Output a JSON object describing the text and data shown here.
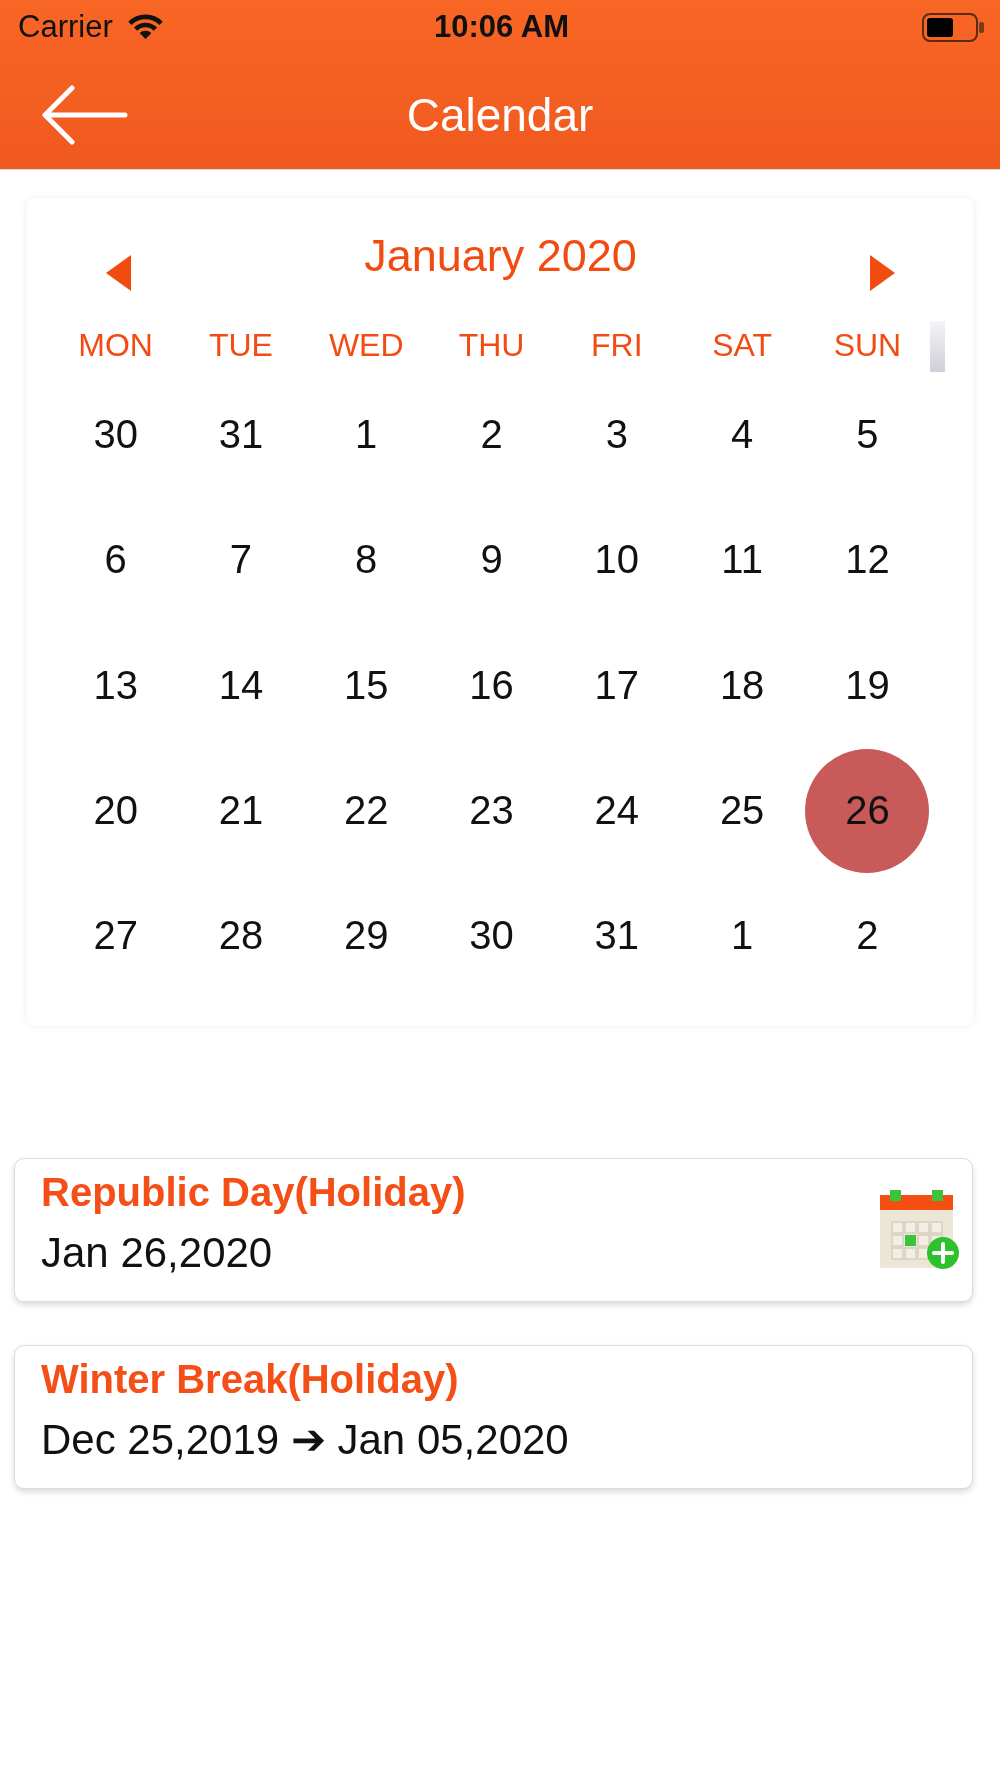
{
  "status_bar": {
    "carrier": "Carrier",
    "time": "10:06 AM"
  },
  "header": {
    "title": "Calendar"
  },
  "calendar": {
    "month": "January 2020",
    "weekdays": [
      "MON",
      "TUE",
      "WED",
      "THU",
      "FRI",
      "SAT",
      "SUN"
    ],
    "weeks": [
      [
        {
          "day": "30",
          "selected": false
        },
        {
          "day": "31",
          "selected": false
        },
        {
          "day": "1",
          "selected": false
        },
        {
          "day": "2",
          "selected": false
        },
        {
          "day": "3",
          "selected": false
        },
        {
          "day": "4",
          "selected": false
        },
        {
          "day": "5",
          "selected": false
        }
      ],
      [
        {
          "day": "6",
          "selected": false
        },
        {
          "day": "7",
          "selected": false
        },
        {
          "day": "8",
          "selected": false
        },
        {
          "day": "9",
          "selected": false
        },
        {
          "day": "10",
          "selected": false
        },
        {
          "day": "11",
          "selected": false
        },
        {
          "day": "12",
          "selected": false
        }
      ],
      [
        {
          "day": "13",
          "selected": false
        },
        {
          "day": "14",
          "selected": false
        },
        {
          "day": "15",
          "selected": false
        },
        {
          "day": "16",
          "selected": false
        },
        {
          "day": "17",
          "selected": false
        },
        {
          "day": "18",
          "selected": false
        },
        {
          "day": "19",
          "selected": false
        }
      ],
      [
        {
          "day": "20",
          "selected": false
        },
        {
          "day": "21",
          "selected": false
        },
        {
          "day": "22",
          "selected": false
        },
        {
          "day": "23",
          "selected": false
        },
        {
          "day": "24",
          "selected": false
        },
        {
          "day": "25",
          "selected": false
        },
        {
          "day": "26",
          "selected": true
        }
      ],
      [
        {
          "day": "27",
          "selected": false
        },
        {
          "day": "28",
          "selected": false
        },
        {
          "day": "29",
          "selected": false
        },
        {
          "day": "30",
          "selected": false
        },
        {
          "day": "31",
          "selected": false
        },
        {
          "day": "1",
          "selected": false
        },
        {
          "day": "2",
          "selected": false
        }
      ]
    ]
  },
  "events": [
    {
      "title": "Republic Day(Holiday)",
      "date": "Jan 26,2020",
      "add_to_calendar": true
    },
    {
      "title": "Winter Break(Holiday)",
      "date": "Dec 25,2019 ➔ Jan 05,2020",
      "add_to_calendar": false
    }
  ]
}
